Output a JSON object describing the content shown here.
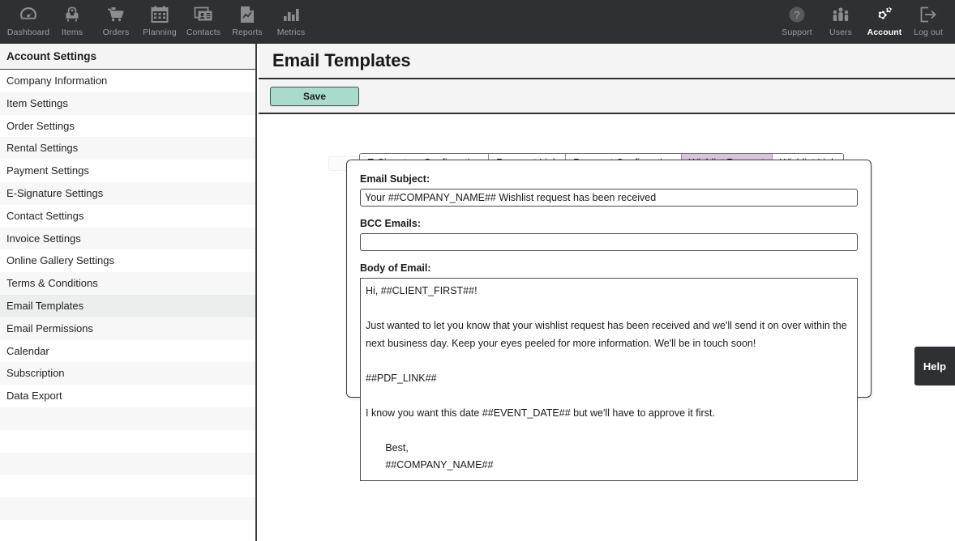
{
  "topnav": {
    "background": "#2f3033",
    "left_items": [
      {
        "label": "Dashboard",
        "icon": "gauge-icon",
        "active": false
      },
      {
        "label": "Items",
        "icon": "armchair-icon",
        "active": false
      },
      {
        "label": "Orders",
        "icon": "cart-icon",
        "active": false
      },
      {
        "label": "Planning",
        "icon": "calendar-icon",
        "active": false
      },
      {
        "label": "Contacts",
        "icon": "contact-card-icon",
        "active": false
      },
      {
        "label": "Reports",
        "icon": "report-chart-icon",
        "active": false
      },
      {
        "label": "Metrics",
        "icon": "bar-chart-icon",
        "active": false
      }
    ],
    "right_items": [
      {
        "label": "Support",
        "icon": "question-circle-icon",
        "active": false
      },
      {
        "label": "Users",
        "icon": "people-group-icon",
        "active": false
      },
      {
        "label": "Account",
        "icon": "gears-icon",
        "active": true
      },
      {
        "label": "Log out",
        "icon": "logout-arrow-icon",
        "active": false
      }
    ]
  },
  "sidebar": {
    "heading": "Account Settings",
    "items": [
      {
        "label": "Company Information",
        "selected": false
      },
      {
        "label": "Item Settings",
        "selected": false
      },
      {
        "label": "Order Settings",
        "selected": false
      },
      {
        "label": "Rental Settings",
        "selected": false
      },
      {
        "label": "Payment Settings",
        "selected": false
      },
      {
        "label": "E-Signature Settings",
        "selected": false
      },
      {
        "label": "Contact Settings",
        "selected": false
      },
      {
        "label": "Invoice Settings",
        "selected": false
      },
      {
        "label": "Online Gallery Settings",
        "selected": false
      },
      {
        "label": "Terms & Conditions",
        "selected": false
      },
      {
        "label": "Email Templates",
        "selected": true
      },
      {
        "label": "Email Permissions",
        "selected": false
      },
      {
        "label": "Calendar",
        "selected": false
      },
      {
        "label": "Subscription",
        "selected": false
      },
      {
        "label": "Data Export",
        "selected": false
      }
    ]
  },
  "header": {
    "title": "Email Templates",
    "save_label": "Save",
    "save_color": "#a8dbcb"
  },
  "tabs": {
    "active_color": "#d9c4de",
    "items": [
      {
        "label": "E-Signature Confirmation",
        "active": false
      },
      {
        "label": "Payment Link",
        "active": false
      },
      {
        "label": "Payment Confirmation",
        "active": false
      },
      {
        "label": "Wishlist Request",
        "active": true
      },
      {
        "label": "Wishlist Link",
        "active": false
      }
    ]
  },
  "form": {
    "subject_label": "Email Subject:",
    "subject_value": "Your ##COMPANY_NAME## Wishlist request has been received",
    "subject_placeholder": "",
    "bcc_label": "BCC  Emails:",
    "bcc_value": "",
    "bcc_placeholder": "",
    "body_label": "Body of Email:",
    "body_value": "Hi, ##CLIENT_FIRST##!\n\nJust wanted to let you know that your wishlist request has been received and we'll send it on over within the next business day. Keep your eyes peeled for more information. We'll be in touch soon!\n\n##PDF_LINK##\n\nI know you want this date ##EVENT_DATE## but we'll have to approve it first.\n\n       Best,\n       ##COMPANY_NAME##",
    "body_placeholder": ""
  },
  "help": {
    "label": "Help"
  }
}
